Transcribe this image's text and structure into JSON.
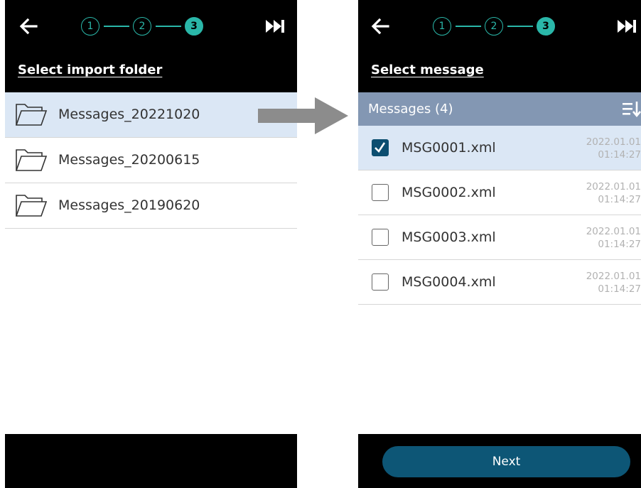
{
  "stepper": {
    "steps": [
      "1",
      "2",
      "3"
    ],
    "current_step": 3,
    "accent_color": "#2ab7a9"
  },
  "icons": {
    "back": "arrow-left-icon",
    "skip": "skip-forward-icon",
    "folder": "folder-open-icon",
    "sort": "sort-icon",
    "check": "checkmark-icon",
    "flow": "arrow-right-icon"
  },
  "left_screen": {
    "title": "Select import folder",
    "folders": [
      {
        "name": "Messages_20221020",
        "selected": true
      },
      {
        "name": "Messages_20200615",
        "selected": false
      },
      {
        "name": "Messages_20190620",
        "selected": false
      }
    ]
  },
  "right_screen": {
    "title": "Select message",
    "list_header": "Messages (4)",
    "messages": [
      {
        "name": "MSG0001.xml",
        "date": "2022.01.01",
        "time": "01:14:27",
        "checked": true
      },
      {
        "name": "MSG0002.xml",
        "date": "2022.01.01",
        "time": "01:14:27",
        "checked": false
      },
      {
        "name": "MSG0003.xml",
        "date": "2022.01.01",
        "time": "01:14:27",
        "checked": false
      },
      {
        "name": "MSG0004.xml",
        "date": "2022.01.01",
        "time": "01:14:27",
        "checked": false
      }
    ],
    "next_label": "Next"
  },
  "colors": {
    "selected_row": "#dbe7f5",
    "header_bar": "#8397b3",
    "primary_button": "#0d5676",
    "flow_arrow": "#8c8c8c"
  }
}
